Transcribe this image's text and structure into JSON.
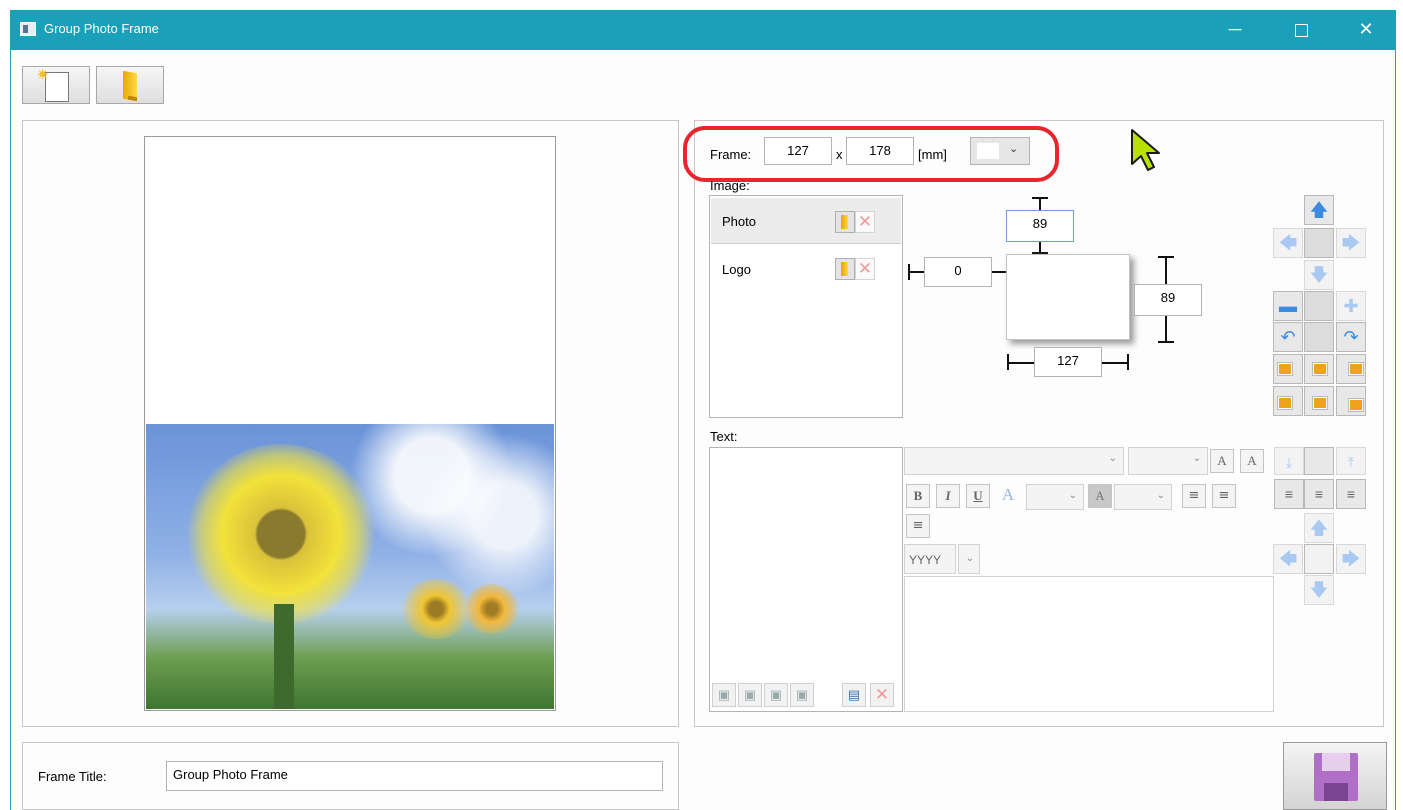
{
  "window": {
    "title": "Group Photo Frame",
    "controls": {
      "minimize": "─",
      "close": "✕"
    }
  },
  "toolbar": {
    "new_icon": "new-document-icon",
    "open_icon": "open-folder-icon"
  },
  "frame": {
    "label": "Frame:",
    "width": "127",
    "separator": "x",
    "height": "178",
    "unit": "[mm]",
    "color": "#ffffff"
  },
  "image": {
    "label": "Image:",
    "items": [
      {
        "label": "Photo",
        "selected": true
      },
      {
        "label": "Logo",
        "selected": false
      }
    ],
    "position": {
      "top": "89",
      "left": "0",
      "right": "89",
      "bottom": "127"
    }
  },
  "text": {
    "label": "Text:",
    "date_format": "YYYY"
  },
  "format_buttons": {
    "bold": "B",
    "italic": "I",
    "underline": "U",
    "font_color": "A",
    "highlight": "A",
    "grow_font": "A",
    "shrink_font": "A"
  },
  "footer": {
    "frame_title_label": "Frame Title:",
    "frame_title_value": "Group Photo Frame"
  },
  "colors": {
    "titlebar": "#1aa0b8",
    "highlight_outline": "#e8242d",
    "cursor": "#b8e000",
    "save_icon": "#b06fc6"
  }
}
